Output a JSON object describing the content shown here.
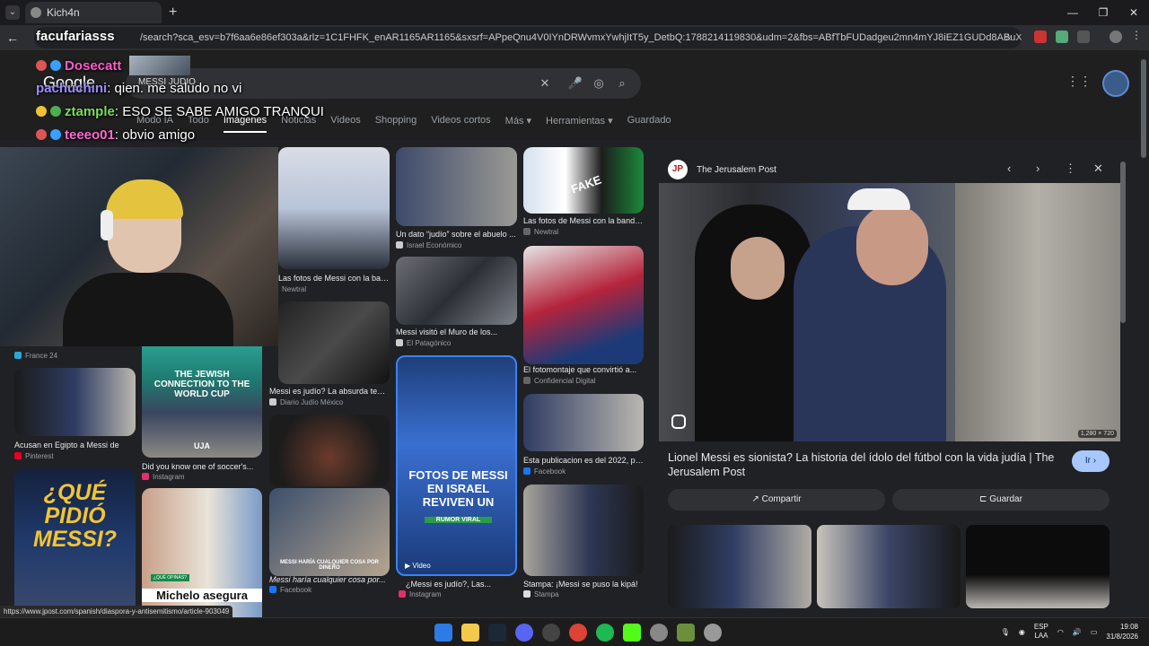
{
  "browser": {
    "tab_title": "Kich4n",
    "new_tab": "+",
    "url": "/search?sca_esv=b7f6aa6e86ef303a&rlz=1C1FHFK_enAR1165AR1165&sxsrf=APpeQnu4V0IYnDRWvmxYwhjItT5y_DetbQ:1788214119830&udm=2&fbs=ABfTbFUDadgeu2mn4mYJ8iEZ1GUDd8ABuXxNzQEi57SWOuuPdWnr6CbjqIObb...",
    "streamer_overlay": "facufariasss",
    "status_url": "https://www.jpost.com/spanish/diaspora-y-antisemitismo/article-903049"
  },
  "google": {
    "logo": "Google",
    "search_query": "MESSI JUDIO",
    "tabs": [
      "Modo IA",
      "Todo",
      "Imágenes",
      "Noticias",
      "Videos",
      "Shopping",
      "Videos cortos",
      "Más ▾",
      "Herramientas ▾",
      "Guardado"
    ],
    "active_tab": "Imágenes"
  },
  "chat": [
    {
      "user": "Dosecatt",
      "text": "",
      "color": "#ff5ccd"
    },
    {
      "user": "pachuchini",
      "text": ": qien. me saludo no vi",
      "color": "#9b8cff"
    },
    {
      "user": "ztample",
      "text": ": ESO SE SABE AMIGO TRANQUI",
      "color": "#7ddc5c"
    },
    {
      "user": "teeeo01",
      "text": ": obvio amigo",
      "color": "#ff6ad5"
    }
  ],
  "results": [
    {
      "label": "Las fotos de Messi con la bander...",
      "source": "Newtral"
    },
    {
      "label": "Un dato “judío” sobre el abuelo ...",
      "source": "Israel Económico"
    },
    {
      "label": "Las fotos de Messi con la bander...",
      "source": "Newtral"
    },
    {
      "label": "Messi visitó el Muro de los...",
      "source": "El Patagónico"
    },
    {
      "label": "El fotomontaje que convirtió a...",
      "source": "Confidencial Digital"
    },
    {
      "label": "Messi es judío? La absurda teorí...",
      "source": "Diario Judío México"
    },
    {
      "label": "Esta publicacion es del 2022, per...",
      "source": "Facebook"
    },
    {
      "label": "",
      "source": "France 24"
    },
    {
      "label": "Acusan en Egipto a Messi de",
      "source": "Pinterest"
    },
    {
      "label": "Did you know one of soccer's...",
      "source": "Instagram"
    },
    {
      "label": "Messi haría cualquier cosa por...",
      "source": "Facebook"
    },
    {
      "label": "¿Messi es judío?, Las...",
      "source": "Instagram"
    },
    {
      "label": "Stampa: ¡Messi se puso la kipá!",
      "source": "Stampa"
    }
  ],
  "overlays": {
    "fake": "FAKE",
    "jewish_connection": "THE JEWISH CONNECTION TO THE WORLD CUP",
    "que_pidio": "¿QUÉ PIDIÓ MESSI?",
    "fotos_israel": "FOTOS DE MESSI EN ISRAEL REVIVEN UN",
    "rumor": "RUMOR VIRAL",
    "michelo": "Michelo asegura",
    "video_badge": "▶ Video",
    "que_opinas": "¿QUÉ OPINAS?",
    "uja": "UJA",
    "messi_haria": "MESSI HARÍA CUALQUIER COSA POR DINERO"
  },
  "panel": {
    "source_name": "The Jerusalem Post",
    "logo_letters": "JP",
    "dimensions": "1,280 × 720",
    "title": "Lionel Messi es sionista? La historia del ídolo del fútbol con la vida judía | The Jerusalem Post",
    "go_button": "Ir ›",
    "share_button": "Compartir",
    "save_button": "Guardar"
  },
  "taskbar": {
    "lang_top": "ESP",
    "lang_bottom": "LAA",
    "time": "19:08",
    "date": "31/8/2026"
  }
}
